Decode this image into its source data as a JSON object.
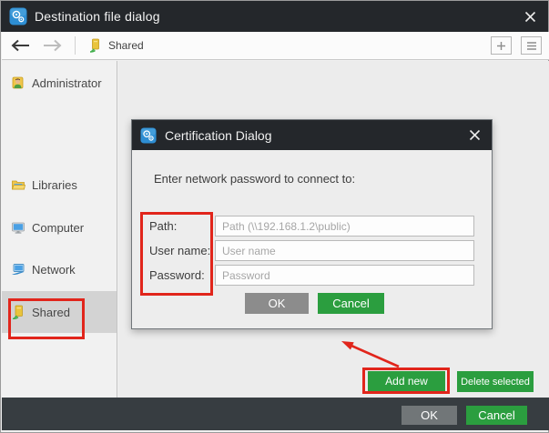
{
  "window": {
    "title": "Destination file dialog"
  },
  "toolbar": {
    "breadcrumb": "Shared"
  },
  "sidebar": {
    "items": [
      {
        "label": "Administrator",
        "selected": false
      },
      {
        "label": "Libraries",
        "selected": false
      },
      {
        "label": "Computer",
        "selected": false
      },
      {
        "label": "Network",
        "selected": false
      },
      {
        "label": "Shared",
        "selected": true
      }
    ]
  },
  "dialog": {
    "title": "Certification Dialog",
    "message": "Enter network password to connect to:",
    "fields": [
      {
        "label": "Path:",
        "placeholder": "Path (\\\\192.168.1.2\\public)",
        "value": ""
      },
      {
        "label": "User name:",
        "placeholder": "User name",
        "value": ""
      },
      {
        "label": "Password:",
        "placeholder": "Password",
        "value": ""
      }
    ],
    "ok_label": "OK",
    "cancel_label": "Cancel"
  },
  "content": {
    "add_new_label": "Add new",
    "delete_selected_label": "Delete selected"
  },
  "footer": {
    "ok_label": "OK",
    "cancel_label": "Cancel"
  },
  "colors": {
    "green_button": "#2b9e3f",
    "annotation_red": "#e1251b",
    "titlebar": "#24272b",
    "footer_bar": "#373d41"
  }
}
